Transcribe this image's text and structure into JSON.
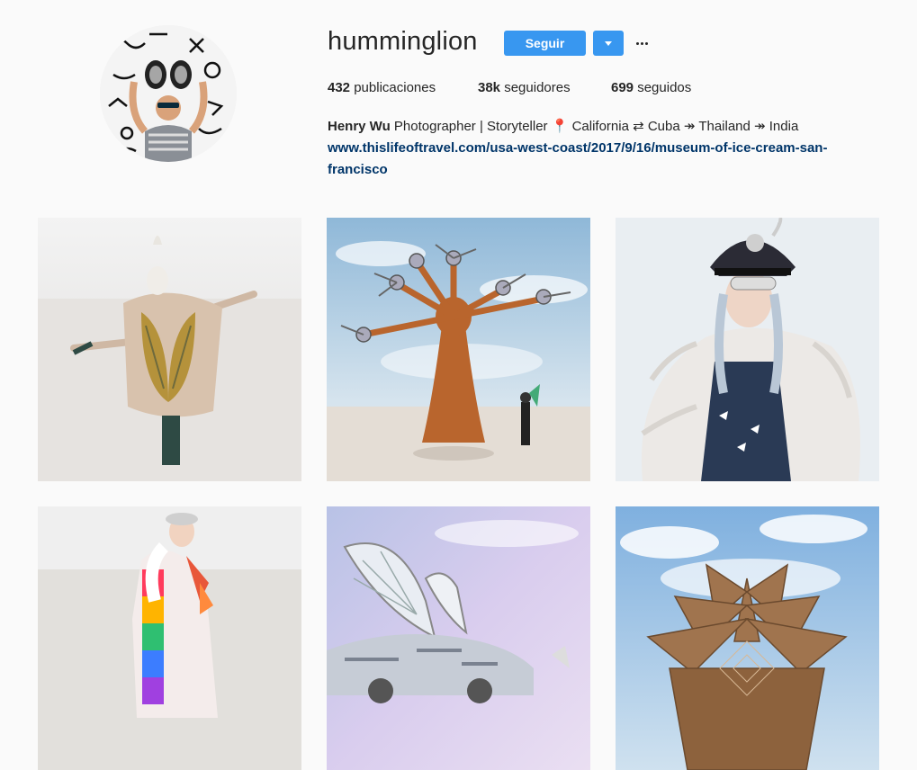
{
  "profile": {
    "username": "humminglion",
    "follow_label": "Seguir",
    "more_options": "•••",
    "stats": {
      "posts_count": "432",
      "posts_label": "publicaciones",
      "followers_count": "38k",
      "followers_label": "seguidores",
      "following_count": "699",
      "following_label": "seguidos"
    },
    "bio": {
      "name": "Henry Wu",
      "text": " Photographer | Storyteller 📍 California ⇄ Cuba ↠ Thailand ↠ India",
      "link_line1": "www.thislifeoftravel.com/usa-west-coast/2017/9/16/museum-of-ice-cream-san-",
      "link_line2": "francisco"
    }
  },
  "colors": {
    "accent": "#3897f0",
    "link": "#003569",
    "background": "#fafafa"
  },
  "posts": [
    {
      "name": "post-winged-cape-dancer"
    },
    {
      "name": "post-metal-tree-sculpture"
    },
    {
      "name": "post-fur-coat-captain-hat"
    },
    {
      "name": "post-rainbow-coat"
    },
    {
      "name": "post-butterfly-art-car"
    },
    {
      "name": "post-wooden-temple-sculpture"
    }
  ]
}
